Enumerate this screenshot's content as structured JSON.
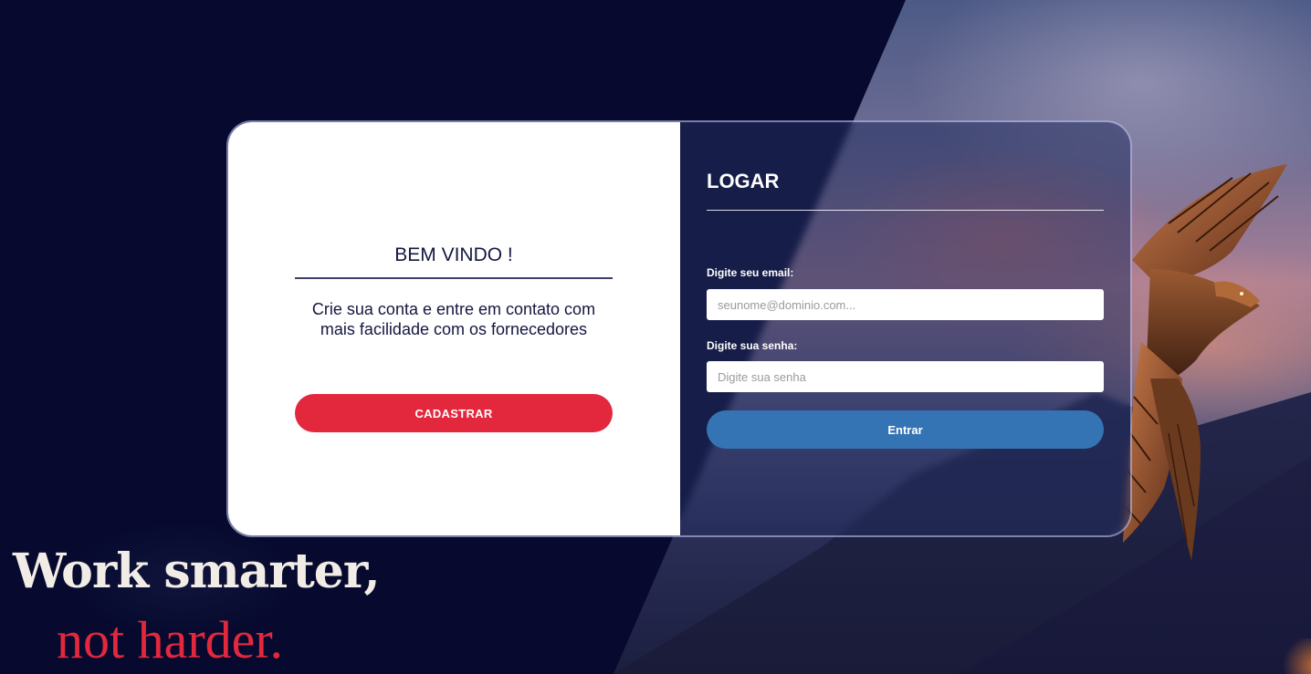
{
  "welcome": {
    "title": "BEM VINDO !",
    "text": "Crie sua conta e entre em contato com mais facilidade com os fornecedores",
    "register_button": "CADASTRAR"
  },
  "login": {
    "title": "LOGAR",
    "email_label": "Digite seu email:",
    "email_placeholder": "seunome@dominio.com...",
    "email_value": "",
    "password_label": "Digite sua senha:",
    "password_placeholder": "Digite sua senha",
    "password_value": "",
    "submit_button": "Entrar"
  },
  "slogan": {
    "line1": "Work smarter,",
    "line2": "not harder."
  },
  "colors": {
    "background": "#070a2e",
    "accent_red": "#e3283e",
    "button_blue": "#3574b4",
    "text_dark": "#15173f"
  },
  "icons": [
    "eagle-illustration"
  ]
}
